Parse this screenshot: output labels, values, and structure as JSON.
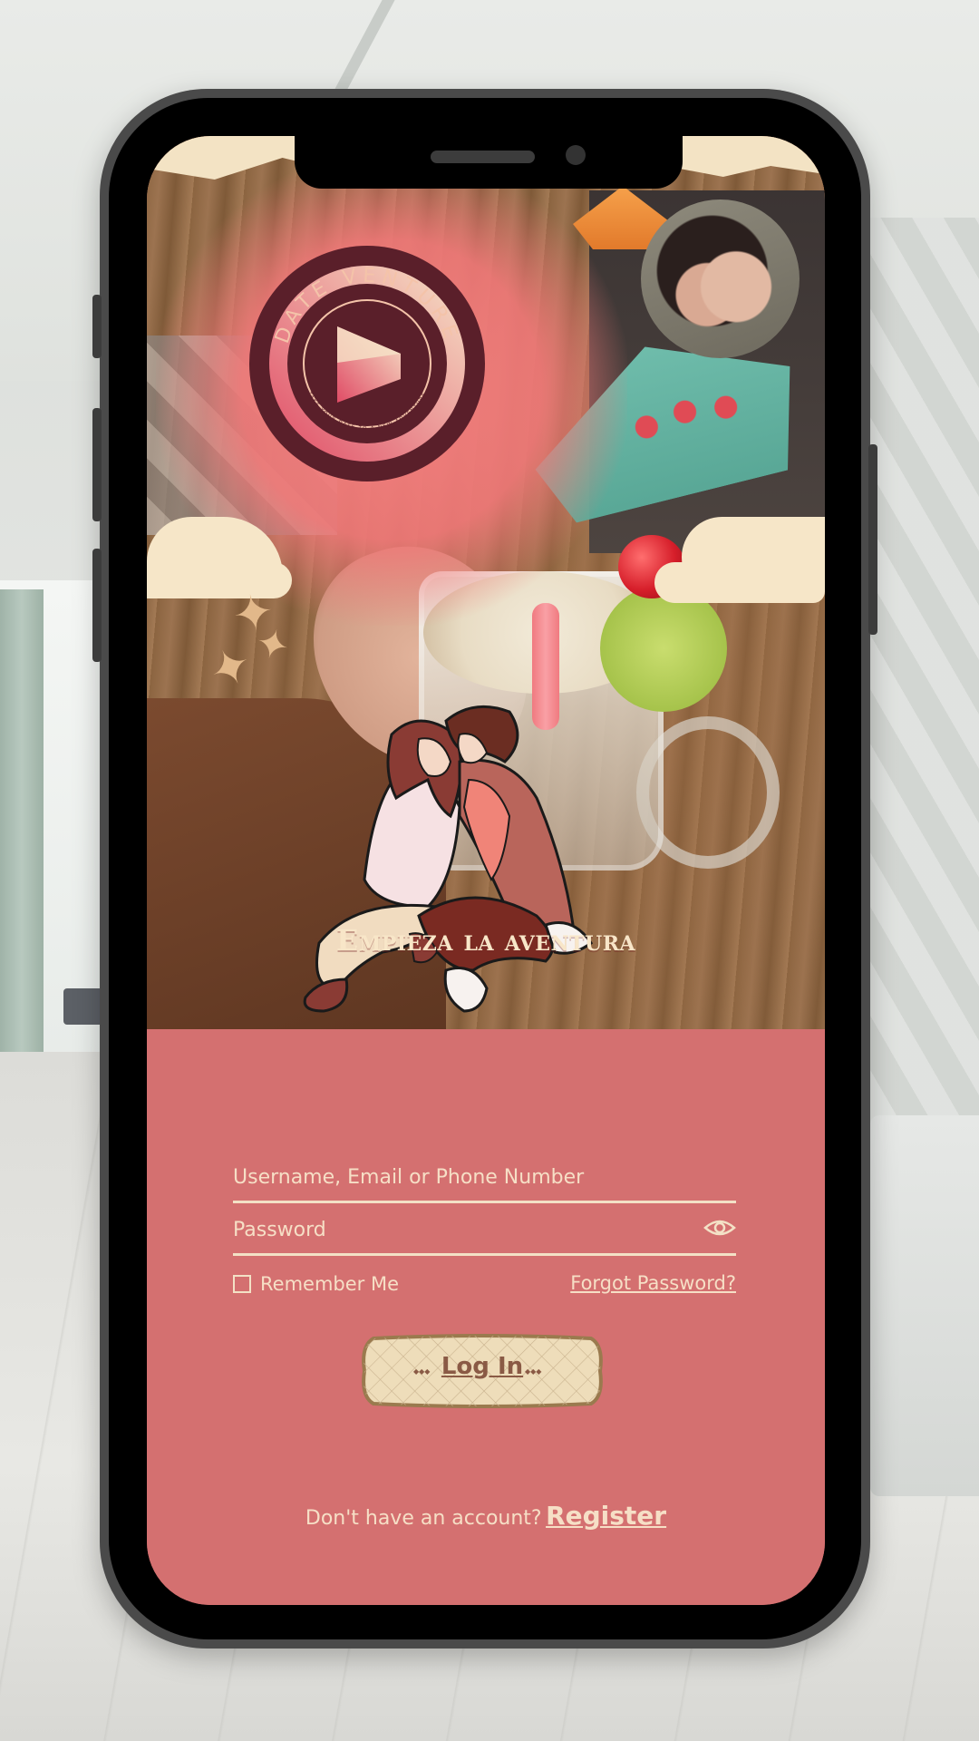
{
  "logo": {
    "brand": "DATE VENTURE",
    "tagline": "TAKE YOUR DATE TO A NEW ADVENTURE"
  },
  "login": {
    "heading": "Empieza la aventura",
    "username_placeholder": "Username, Email or Phone Number",
    "username_value": "",
    "password_placeholder": "Password",
    "password_value": "",
    "remember_label": "Remember Me",
    "remember_checked": false,
    "forgot_label": "Forgot Password?",
    "submit_label": "Log In",
    "register_prompt": "Don't have an account?",
    "register_label": "Register"
  },
  "icons": {
    "password_toggle": "eye-icon"
  },
  "colors": {
    "form_background": "#d47070",
    "text_cream": "#f6dfc6",
    "logo_dark": "#5a1f2a",
    "logo_light": "#f4c3a9",
    "button_parchment": "#eeddba"
  }
}
